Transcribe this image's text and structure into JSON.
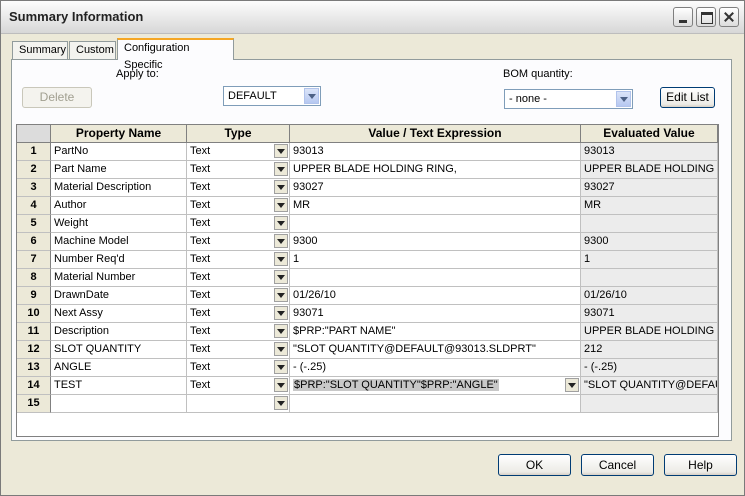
{
  "window": {
    "title": "Summary Information"
  },
  "tabs": [
    {
      "label": "Summary"
    },
    {
      "label": "Custom"
    },
    {
      "label": "Configuration Specific"
    }
  ],
  "controls": {
    "apply_to_label": "Apply to:",
    "delete_label": "Delete",
    "apply_to_value": "DEFAULT",
    "bom_label": "BOM quantity:",
    "bom_value": "- none -",
    "edit_list_label": "Edit List"
  },
  "table": {
    "headers": [
      "Property Name",
      "Type",
      "Value / Text Expression",
      "Evaluated Value"
    ],
    "rows": [
      {
        "num": "1",
        "name": "PartNo",
        "type": "Text",
        "value": "93013",
        "evaluated": "93013"
      },
      {
        "num": "2",
        "name": "Part Name",
        "type": "Text",
        "value": "UPPER BLADE HOLDING RING,",
        "evaluated": "UPPER BLADE HOLDING RI"
      },
      {
        "num": "3",
        "name": "Material Description",
        "type": "Text",
        "value": "93027",
        "evaluated": "93027"
      },
      {
        "num": "4",
        "name": "Author",
        "type": "Text",
        "value": "MR",
        "evaluated": "MR"
      },
      {
        "num": "5",
        "name": "Weight",
        "type": "Text",
        "value": "",
        "evaluated": ""
      },
      {
        "num": "6",
        "name": "Machine Model",
        "type": "Text",
        "value": "9300",
        "evaluated": "9300"
      },
      {
        "num": "7",
        "name": "Number Req'd",
        "type": "Text",
        "value": "1",
        "evaluated": "1"
      },
      {
        "num": "8",
        "name": "Material Number",
        "type": "Text",
        "value": "",
        "evaluated": ""
      },
      {
        "num": "9",
        "name": "DrawnDate",
        "type": "Text",
        "value": "01/26/10",
        "evaluated": "01/26/10"
      },
      {
        "num": "10",
        "name": "Next Assy",
        "type": "Text",
        "value": "93071",
        "evaluated": "93071"
      },
      {
        "num": "11",
        "name": "Description",
        "type": "Text",
        "value": "$PRP:\"PART NAME\"",
        "evaluated": "UPPER BLADE HOLDING RI"
      },
      {
        "num": "12",
        "name": "SLOT QUANTITY",
        "type": "Text",
        "value": "\"SLOT QUANTITY@DEFAULT@93013.SLDPRT\"",
        "evaluated": "212"
      },
      {
        "num": "13",
        "name": "ANGLE",
        "type": "Text",
        "value": "- (-.25)",
        "evaluated": "- (-.25)"
      },
      {
        "num": "14",
        "name": "TEST",
        "type": "Text",
        "value": "$PRP:\"SLOT QUANTITY\"$PRP:\"ANGLE\"",
        "evaluated": "\"SLOT QUANTITY@DEFAUL"
      },
      {
        "num": "15",
        "name": "",
        "type": "",
        "value": "",
        "evaluated": ""
      }
    ]
  },
  "footer": {
    "ok_label": "OK",
    "cancel_label": "Cancel",
    "help_label": "Help"
  }
}
